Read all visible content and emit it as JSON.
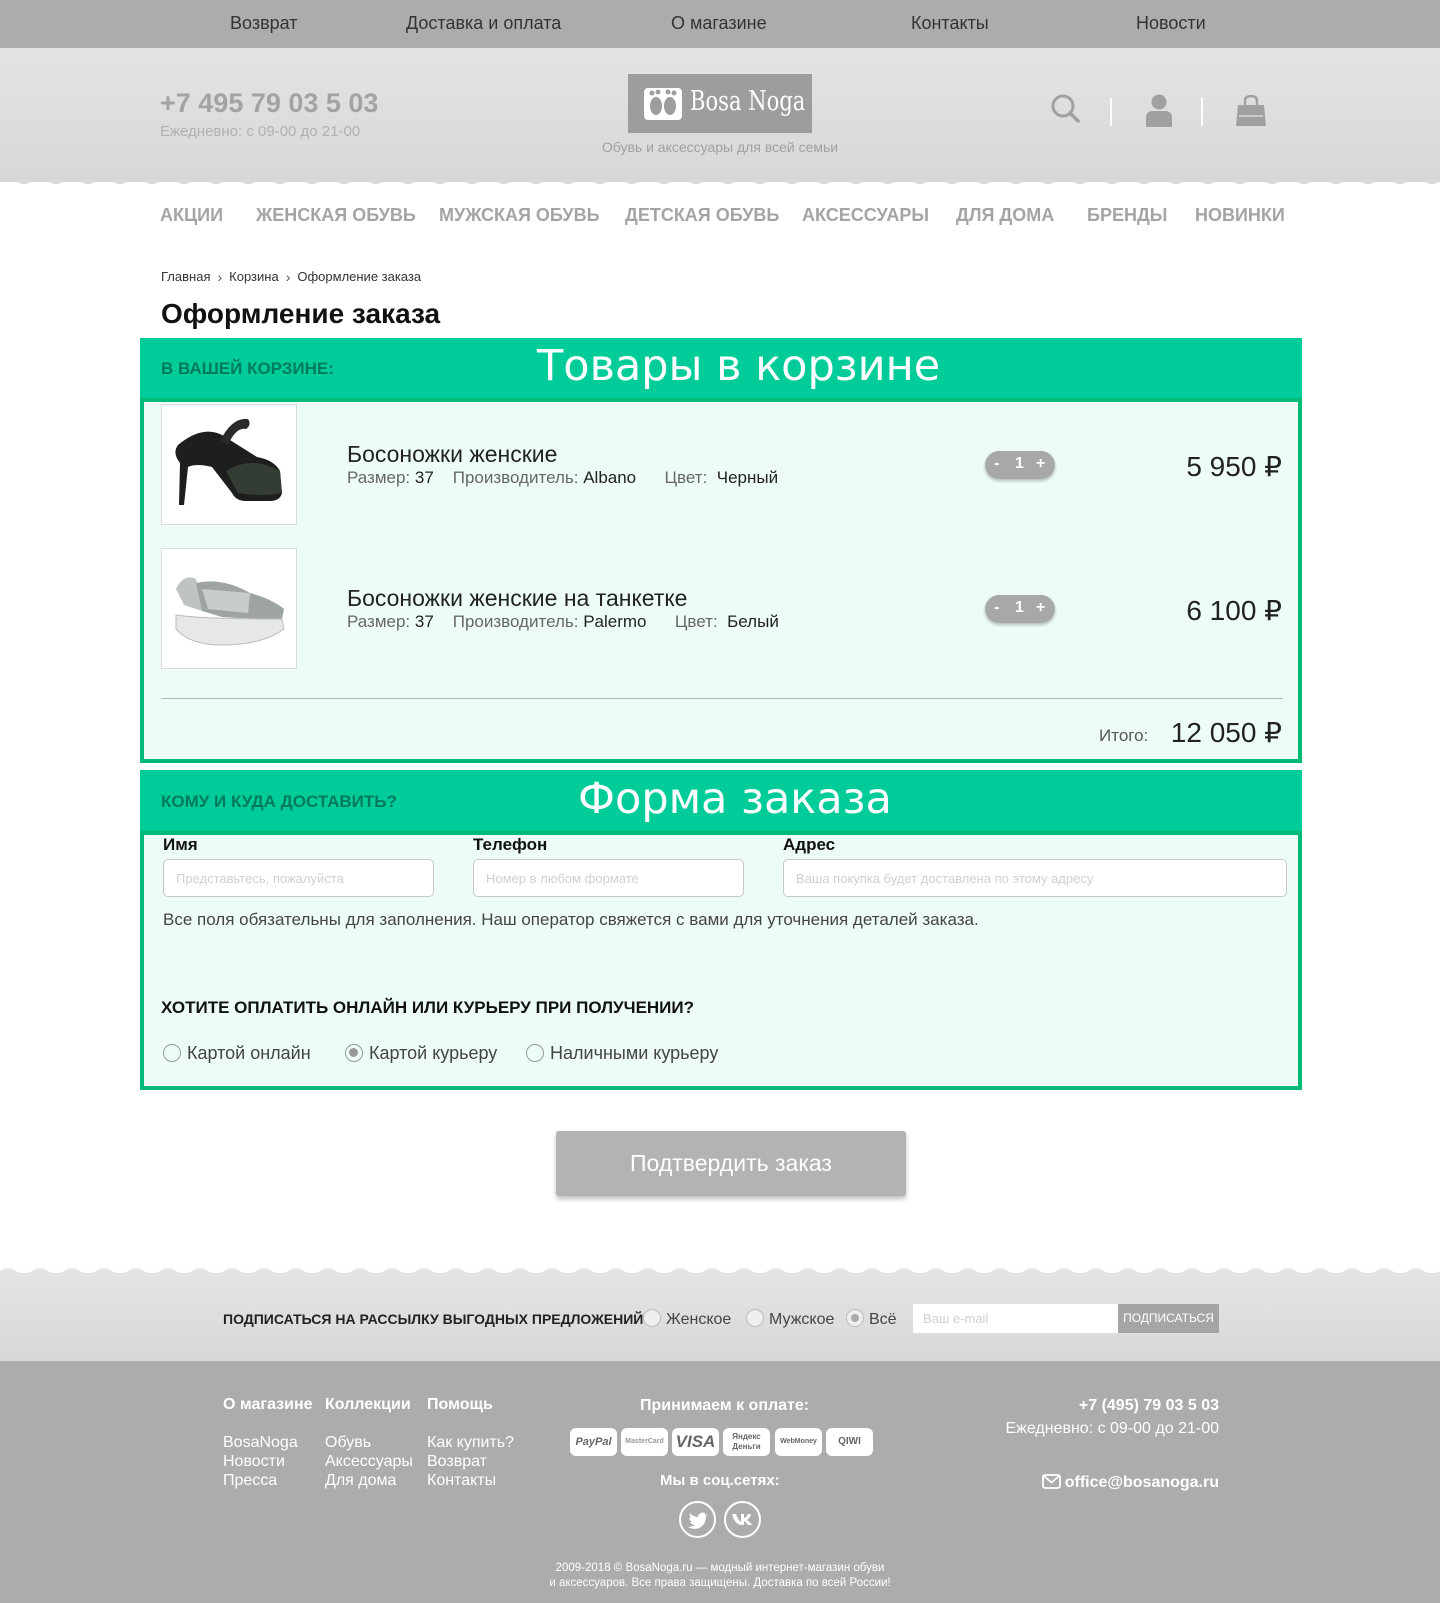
{
  "top_nav": [
    "Возврат",
    "Доставка и оплата",
    "О магазине",
    "Контакты",
    "Новости"
  ],
  "header": {
    "phone": "+7 495 79 03 5 03",
    "hours": "Ежедневно: с 09-00 до 21-00",
    "logo_text": "Bosa Noga",
    "tagline": "Обувь и аксессуары для всей семьи"
  },
  "categories": [
    "АКЦИИ",
    "ЖЕНСКАЯ ОБУВЬ",
    "МУЖСКАЯ ОБУВЬ",
    "ДЕТСКАЯ ОБУВЬ",
    "АКСЕССУАРЫ",
    "ДЛЯ ДОМА",
    "БРЕНДЫ",
    "НОВИНКИ"
  ],
  "breadcrumb": [
    "Главная",
    "Корзина",
    "Оформление заказа"
  ],
  "page_title": "Оформление заказа",
  "cart": {
    "label": "В ВАШЕЙ КОРЗИНЕ:",
    "caption": "Товары в корзине",
    "size_label": "Размер:",
    "maker_label": "Производитель:",
    "color_label": "Цвет:",
    "items": [
      {
        "title": "Босоножки женские",
        "size": "37",
        "maker": "Albano",
        "color": "Черный",
        "qty": "1",
        "price": "5 950 ₽"
      },
      {
        "title": "Босоножки женские на танкетке",
        "size": "37",
        "maker": "Palermo",
        "color": "Белый",
        "qty": "1",
        "price": "6 100 ₽"
      }
    ],
    "total_label": "Итого:",
    "total": "12 050 ₽"
  },
  "order": {
    "label": "КОМУ И КУДА ДОСТАВИТЬ?",
    "caption": "Форма заказа",
    "fields": [
      {
        "label": "Имя",
        "placeholder": "Представьтесь, пожалуйста",
        "value": ""
      },
      {
        "label": "Телефон",
        "placeholder": "Номер в любом формате",
        "value": ""
      },
      {
        "label": "Адрес",
        "placeholder": "Ваша покупка будет доставлена по этому адресу",
        "value": ""
      }
    ],
    "note": "Все поля обязательны для заполнения. Наш оператор свяжется с вами для уточнения деталей заказа.",
    "payment_question": "ХОТИТЕ ОПЛАТИТЬ ОНЛАЙН ИЛИ КУРЬЕРУ ПРИ ПОЛУЧЕНИИ?",
    "payment_options": [
      "Картой онлайн",
      "Картой курьеру",
      "Наличными курьеру"
    ],
    "payment_selected": "Картой курьеру",
    "confirm_label": "Подтвердить заказ"
  },
  "subscribe": {
    "title": "ПОДПИСАТЬСЯ НА РАССЫЛКУ ВЫГОДНЫХ ПРЕДЛОЖЕНИЙ",
    "options": [
      "Женское",
      "Мужское",
      "Всё"
    ],
    "selected": "Всё",
    "email_placeholder": "Ваш e-mail",
    "button": "ПОДПИСАТЬСЯ"
  },
  "footer": {
    "columns": [
      {
        "title": "О магазине",
        "links": [
          "BosaNoga",
          "Новости",
          "Пресса"
        ]
      },
      {
        "title": "Коллекции",
        "links": [
          "Обувь",
          "Аксессуары",
          "Для дома"
        ]
      },
      {
        "title": "Помощь",
        "links": [
          "Как купить?",
          "Возврат",
          "Контакты"
        ]
      }
    ],
    "payment_title": "Принимаем к оплате:",
    "payment_logos": [
      "PayPal",
      "MasterCard",
      "VISA",
      "Яндекс Деньги",
      "WebMoney",
      "QIWI"
    ],
    "social_title": "Мы в соц.сетях:",
    "social": [
      "twitter-icon",
      "vk-icon"
    ],
    "phone": "+7 (495) 79 03 5 03",
    "hours": "Ежедневно: с 09-00 до 21-00",
    "email": "office@bosanoga.ru",
    "copyright_1": "2009-2018 © BosaNoga.ru — модный интернет-магазин обуви",
    "copyright_2": "и аксессуаров. Все права защищены. Доставка по всей России!"
  },
  "colors": {
    "accent": "#00cc99",
    "accent_border": "#00bb77",
    "panel_bg": "#eefcf7",
    "gray": "#acacac"
  }
}
